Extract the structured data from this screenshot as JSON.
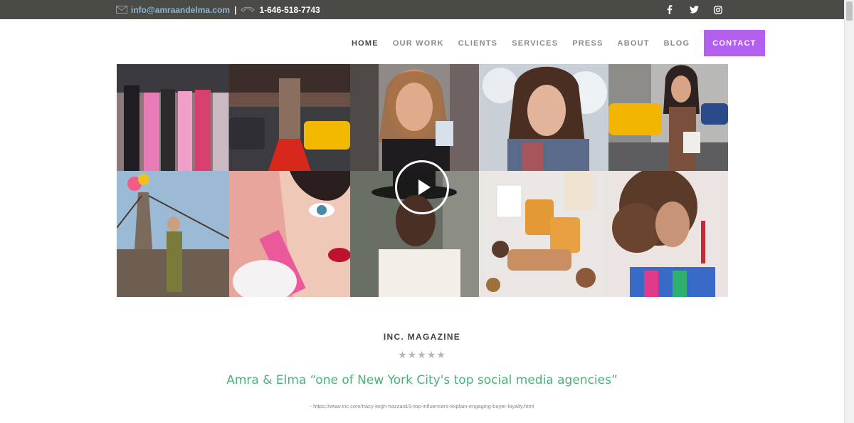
{
  "topbar": {
    "email": "info@amraandelma.com",
    "separator": "|",
    "phone": "1-646-518-7743",
    "icons": [
      "envelope-icon",
      "phone-icon"
    ],
    "socials": [
      "facebook-icon",
      "twitter-icon",
      "instagram-icon"
    ]
  },
  "nav": {
    "items": [
      "HOME",
      "OUR WORK",
      "CLIENTS",
      "SERVICES",
      "PRESS",
      "ABOUT",
      "BLOG"
    ],
    "active": "HOME",
    "contact": "CONTACT"
  },
  "gallery": {
    "play_icon": "play-icon"
  },
  "press": {
    "title": "INC. MAGAZINE",
    "stars": "★★★★★",
    "quote": "Amra & Elma “one of New York City's top social media agencies”",
    "source": "- https://www.inc.com/tracy-leigh-hazzard/3-top-influencers-explain-engaging-buyer-loyalty.html"
  },
  "colors": {
    "topbar_bg": "#4a4a47",
    "email": "#8fb6cf",
    "contact_bg": "#b35ff0",
    "quote": "#4cb07b"
  }
}
